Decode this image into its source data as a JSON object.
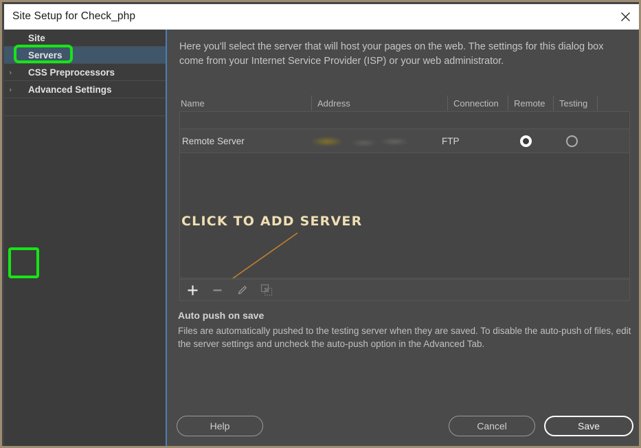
{
  "window": {
    "title": "Site Setup for Check_php",
    "close_label": "×"
  },
  "sidebar": {
    "items": [
      {
        "label": "Site",
        "caret": "",
        "selected": false
      },
      {
        "label": "Servers",
        "caret": "",
        "selected": true
      },
      {
        "label": "CSS Preprocessors",
        "caret": "›",
        "selected": false
      },
      {
        "label": "Advanced Settings",
        "caret": "›",
        "selected": false
      }
    ]
  },
  "main": {
    "intro": "Here you'll select the server that will host your pages on the web. The settings for this dialog box come from your Internet Service Provider (ISP) or your web administrator.",
    "table": {
      "columns": [
        "Name",
        "Address",
        "Connection",
        "Remote",
        "Testing"
      ],
      "rows": [
        {
          "name": "Remote Server",
          "address": "",
          "address_redacted": true,
          "connection": "FTP",
          "remote": true,
          "testing": false
        }
      ]
    },
    "toolbar": {
      "add_label": "+",
      "remove_label": "−",
      "edit_label": "edit",
      "duplicate_label": "duplicate"
    },
    "auto_push": {
      "title": "Auto push on save",
      "body": "Files are automatically pushed to the testing server when they are saved. To disable the auto-push of files, edit the server settings and uncheck the auto-push option in the Advanced Tab."
    },
    "footer": {
      "help": "Help",
      "cancel": "Cancel",
      "save": "Save"
    }
  },
  "annotations": {
    "callout_text": "CLICK TO ADD SERVER",
    "callout_color": "#f0dfb4",
    "line_color": "#c2822c",
    "highlight_color": "#16e516",
    "highlighted_targets": [
      "Servers",
      "+"
    ]
  },
  "colors": {
    "window_border": "#9c8d73",
    "titlebar_bg": "#ffffff",
    "sidebar_bg": "#3c3c3c",
    "sidebar_selected_bg": "#3f566b",
    "main_bg": "#4a4a4a",
    "divider_blue": "#4a7fb5"
  }
}
